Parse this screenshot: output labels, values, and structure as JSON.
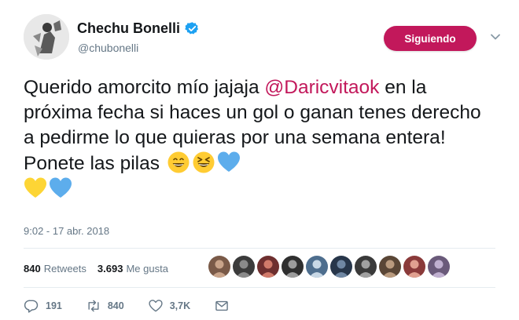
{
  "author": {
    "display_name": "Chechu Bonelli",
    "handle": "@chubonelli",
    "verified_icon": "verified-badge-icon"
  },
  "follow_button": {
    "label": "Siguiendo"
  },
  "menu": {
    "icon": "chevron-down-icon"
  },
  "tweet": {
    "text_part1": "Querido amorcito mío jajaja ",
    "mention": "@Daricvitaok",
    "text_part2": " en la próxima fecha si haces un gol o ganan tenes derecho a pedirme lo que quieras por una semana entera! Ponete las pilas",
    "emojis": [
      "grinning-smiling-eyes-emoji",
      "squinting-laughing-emoji",
      "blue-heart-emoji",
      "yellow-heart-emoji",
      "blue-heart-emoji"
    ],
    "timestamp": "9:02 - 17 abr. 2018"
  },
  "stats": {
    "retweets_count": "840",
    "retweets_label": "Retweets",
    "likes_count": "3.693",
    "likes_label": "Me gusta",
    "liker_avatar_count": 10
  },
  "actions": {
    "reply_count": "191",
    "retweet_count": "840",
    "like_count": "3,7K"
  },
  "colors": {
    "accent": "#c2185b",
    "verified": "#1da1f2",
    "muted": "#657786",
    "text": "#14171a"
  }
}
